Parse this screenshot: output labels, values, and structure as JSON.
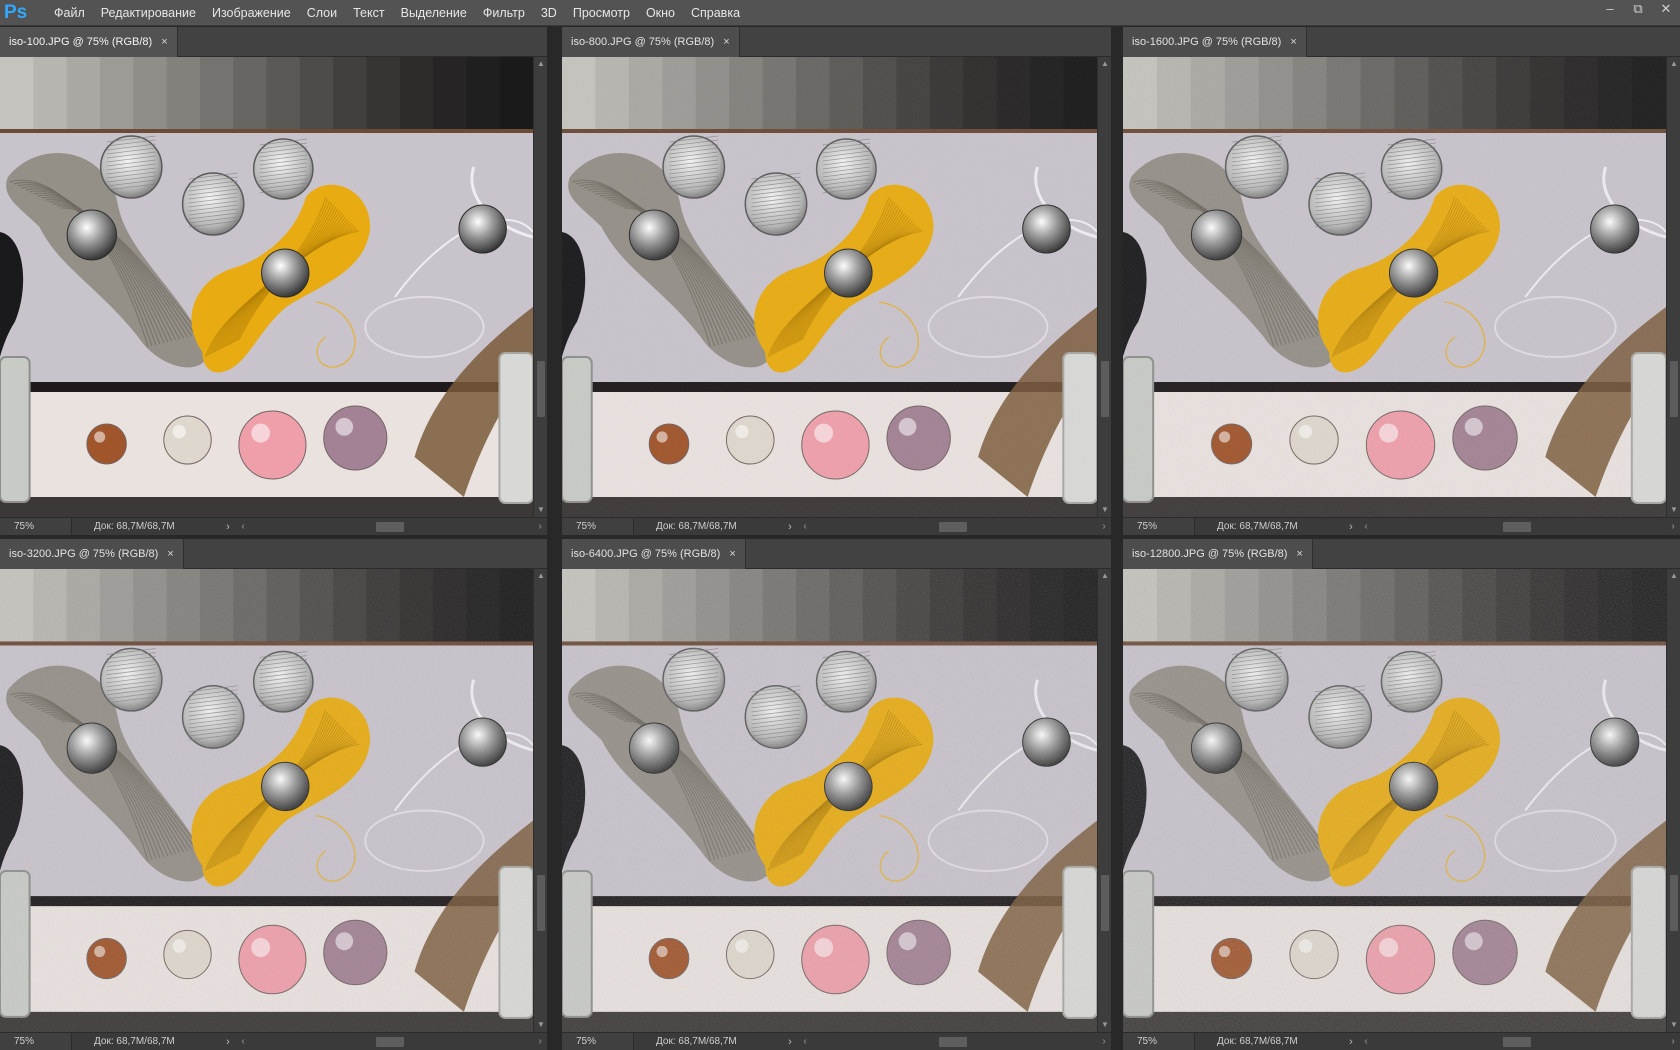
{
  "app": {
    "logo": "Ps",
    "menu": [
      "Файл",
      "Редактирование",
      "Изображение",
      "Слои",
      "Текст",
      "Выделение",
      "Фильтр",
      "3D",
      "Просмотр",
      "Окно",
      "Справка"
    ],
    "window_controls": {
      "minimize": "–",
      "restore": "⧉",
      "close": "✕"
    }
  },
  "documents": [
    {
      "title": "iso-100.JPG @ 75% (RGB/8)",
      "close": "×",
      "zoom": "75%",
      "doc_info": "Док: 68,7M/68,7M",
      "active": true,
      "noise": 0
    },
    {
      "title": "iso-800.JPG @ 75% (RGB/8)",
      "close": "×",
      "zoom": "75%",
      "doc_info": "Док: 68,7M/68,7M",
      "active": false,
      "noise": 1
    },
    {
      "title": "iso-1600.JPG @ 75% (RGB/8)",
      "close": "×",
      "zoom": "75%",
      "doc_info": "Док: 68,7M/68,7M",
      "active": false,
      "noise": 2
    },
    {
      "title": "iso-3200.JPG @ 75% (RGB/8)",
      "close": "×",
      "zoom": "75%",
      "doc_info": "Док: 68,7M/68,7M",
      "active": false,
      "noise": 3
    },
    {
      "title": "iso-6400.JPG @ 75% (RGB/8)",
      "close": "×",
      "zoom": "75%",
      "doc_info": "Док: 68,7M/68,7M",
      "active": false,
      "noise": 4
    },
    {
      "title": "iso-12800.JPG @ 75% (RGB/8)",
      "close": "×",
      "zoom": "75%",
      "doc_info": "Док: 68,7M/68,7M",
      "active": false,
      "noise": 5
    }
  ],
  "scene": {
    "gray_steps": [
      "#c5c3bd",
      "#b7b5af",
      "#aaa8a2",
      "#9d9b96",
      "#908e89",
      "#83817c",
      "#75736f",
      "#686663",
      "#5b5956",
      "#4e4c4a",
      "#42403e",
      "#373534",
      "#2e2c2b",
      "#262424",
      "#201f1f",
      "#1b1a1a"
    ],
    "background": "#c9c3cc",
    "strip_bg": "#e9e2df",
    "thread_color": "#e8ac12",
    "twine_color": "#8e8a80",
    "hair_color": "#7a5a3a",
    "bead_colors": [
      "#9a4a1c",
      "#ded7cc",
      "#ef9aa6",
      "#9c7a8e"
    ]
  }
}
